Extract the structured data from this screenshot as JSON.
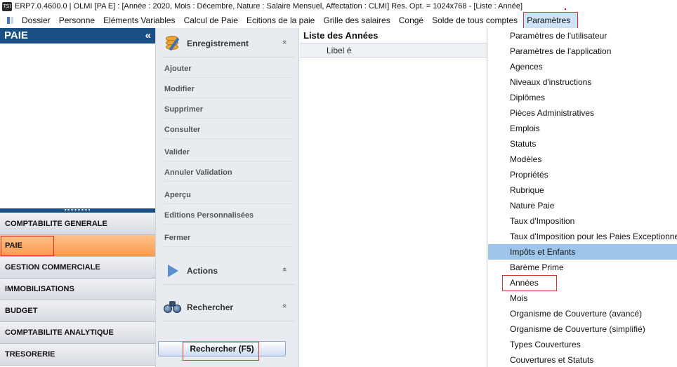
{
  "titlebar": {
    "icon_text": "TSI",
    "title": "ERP7.0.4600.0 | OLMI [PA E] : [Année : 2020, Mois : Décembre, Nature : Salaire Mensuel, Affectation : CLMI] Res. Opt. = 1024x768 - [Liste : Année]"
  },
  "menubar": {
    "items": [
      "Dossier",
      "Personne",
      "Eléments Variables",
      "Calcul de Paie",
      "Ecitions de la paie",
      "Grille des salaires",
      "Congé",
      "Solde de tous comptes",
      "Paramètres"
    ],
    "active_index": 8
  },
  "left_panel": {
    "header": "PAIE",
    "collapse_glyph": "«",
    "modules": [
      "COMPTABILITE GENERALE",
      "PAIE",
      "GESTION COMMERCIALE",
      "IMMOBILISATIONS",
      "BUDGET",
      "COMPTABILITE ANALYTIQUE",
      "TRESORERIE"
    ],
    "active_module": "PAIE"
  },
  "action_panel": {
    "enregistrement": {
      "title": "Enregistrement",
      "items": [
        "Ajouter",
        "Modifier",
        "Supprimer",
        "Consulter",
        "Valider",
        "Annuler Validation",
        "Aperçu",
        "Editions Personnalisées",
        "Fermer"
      ]
    },
    "actions": {
      "title": "Actions"
    },
    "rechercher": {
      "title": "Rechercher"
    },
    "search_button": "Rechercher (F5)",
    "chevron": "«"
  },
  "list": {
    "title": "Liste des Années",
    "column": "Libel é"
  },
  "dropdown": {
    "items": [
      "Paramètres de l'utilisateur",
      "Paramètres de l'application",
      "Agences",
      "Niveaux d'instructions",
      "Diplômes",
      "Pièces Administratives",
      "Emplois",
      "Statuts",
      "Modèles",
      "Propriétés",
      "Rubrique",
      "Nature Paie",
      "Taux d'Imposition",
      "Taux d'Imposition pour les Paies Exceptionnelles",
      "Impôts et Enfants",
      "Barème Prime",
      "Années",
      "Mois",
      "Organisme de Couverture (avancé)",
      "Organisme de Couverture (simplifié)",
      "Types Couvertures",
      "Couvertures et Statuts"
    ],
    "hover_item": "Impôts et Enfants",
    "target_item": "Années"
  },
  "colors": {
    "header_blue": "#1a4f86",
    "active_orange": "#fb9b4c",
    "highlight_red": "#e03030",
    "hover_blue": "#9ec5ea",
    "menu_active": "#cfe3f7"
  }
}
